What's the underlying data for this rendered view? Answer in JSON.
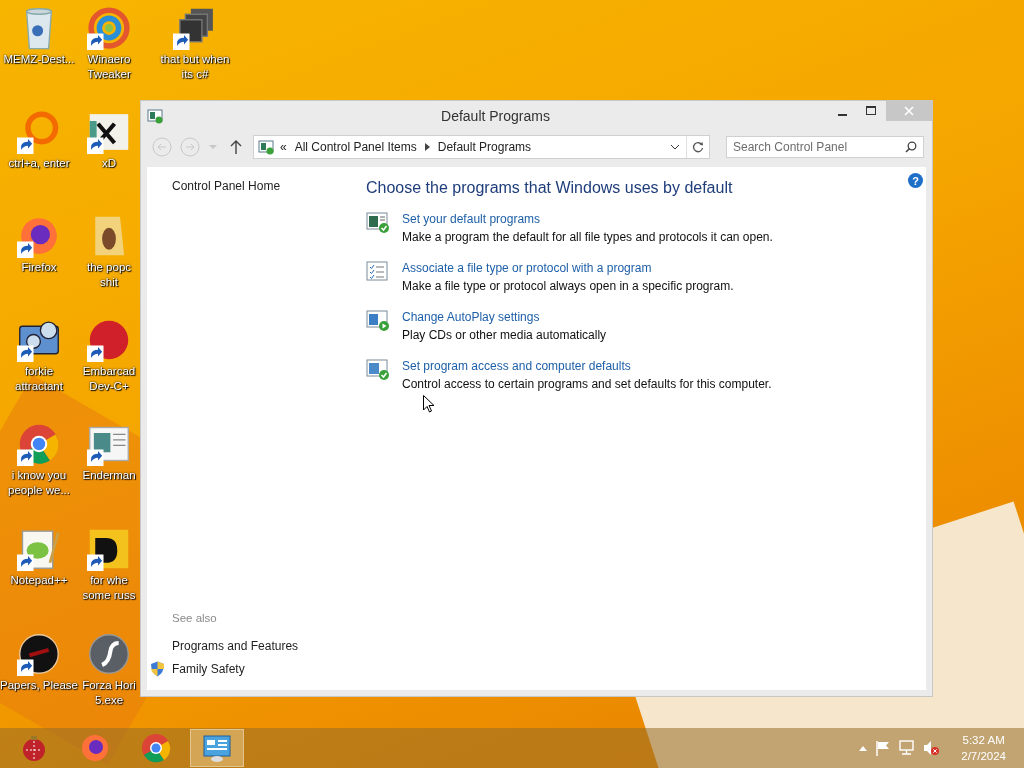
{
  "desktop_columns": [
    [
      {
        "kind": "bin",
        "label_lines": [
          "MEMZ-Dest..."
        ],
        "shortcut": false
      },
      {
        "kind": "ring",
        "label_lines": [
          "ctrl+a, enter"
        ],
        "shortcut": true
      },
      {
        "kind": "fox",
        "label_lines": [
          "Firefox"
        ],
        "shortcut": true
      },
      {
        "kind": "gears",
        "label_lines": [
          "forkie",
          "attractant"
        ],
        "shortcut": true
      },
      {
        "kind": "chrome",
        "label_lines": [
          "i know you",
          "people we..."
        ],
        "shortcut": true
      },
      {
        "kind": "notepad",
        "label_lines": [
          "Notepad++"
        ],
        "shortcut": true
      },
      {
        "kind": "darkcircle",
        "label_lines": [
          "Papers, Please"
        ],
        "shortcut": true
      }
    ],
    [
      {
        "kind": "swirl",
        "label_lines": [
          "Winaero",
          "Tweaker"
        ],
        "shortcut": true
      },
      {
        "kind": "tile",
        "label_lines": [
          "xD"
        ],
        "shortcut": true
      },
      {
        "kind": "folder",
        "label_lines": [
          "the popc",
          "shit"
        ],
        "shortcut": false
      },
      {
        "kind": "redcircle",
        "label_lines": [
          "Embarcad",
          "Dev-C+"
        ],
        "shortcut": true
      },
      {
        "kind": "doc",
        "label_lines": [
          "Enderman"
        ],
        "shortcut": true
      },
      {
        "kind": "yellowtile",
        "label_lines": [
          "for whe",
          "some russ"
        ],
        "shortcut": true
      },
      {
        "kind": "flash",
        "label_lines": [
          "Forza Hori",
          "5.exe"
        ],
        "shortcut": false
      }
    ],
    [
      {
        "kind": "stack",
        "label_lines": [
          "that but when",
          "its c#"
        ],
        "shortcut": true
      }
    ]
  ],
  "window": {
    "title": "Default Programs",
    "nav": {
      "back_disabled": true,
      "forward_disabled": true
    },
    "address": {
      "overflow": "«",
      "crumbs": [
        "All Control Panel Items",
        "Default Programs"
      ]
    },
    "search": {
      "placeholder": "Search Control Panel"
    },
    "help_glyph": "?",
    "sidebar": {
      "home": "Control Panel Home",
      "see_also": "See also",
      "links": [
        {
          "label": "Programs and Features",
          "shield": false
        },
        {
          "label": "Family Safety",
          "shield": true
        }
      ]
    },
    "heading": "Choose the programs that Windows uses by default",
    "tasks": [
      {
        "kind": "check",
        "link": "Set your default programs",
        "description": "Make a program the default for all file types and protocols it can open."
      },
      {
        "kind": "list",
        "link": "Associate a file type or protocol with a program",
        "description": "Make a file type or protocol always open in a specific program."
      },
      {
        "kind": "play",
        "link": "Change AutoPlay settings",
        "description": "Play CDs or other media automatically"
      },
      {
        "kind": "check2",
        "link": "Set program access and computer defaults",
        "description": "Control access to certain programs and set defaults for this computer."
      }
    ]
  },
  "taskbar": {
    "items": [
      {
        "kind": "ornament",
        "selected": false
      },
      {
        "kind": "fox",
        "selected": false
      },
      {
        "kind": "chrome",
        "selected": false
      },
      {
        "kind": "panel",
        "selected": true
      }
    ],
    "time": "5:32 AM",
    "date": "2/7/2024",
    "volume_muted": true
  }
}
